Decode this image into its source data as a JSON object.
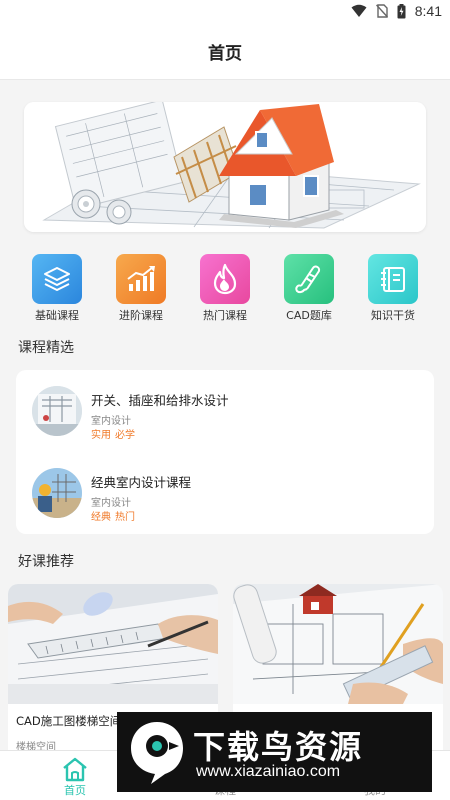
{
  "status_bar": {
    "time": "8:41"
  },
  "header": {
    "title": "首页"
  },
  "categories": [
    {
      "label": "基础课程",
      "icon": "layers-icon",
      "color": "#3aa0ea"
    },
    {
      "label": "进阶课程",
      "icon": "bar-chart-icon",
      "color": "#f39237"
    },
    {
      "label": "热门课程",
      "icon": "flame-icon",
      "color": "#f25fbe"
    },
    {
      "label": "CAD题库",
      "icon": "scroll-icon",
      "color": "#3fd496"
    },
    {
      "label": "知识干货",
      "icon": "notebook-icon",
      "color": "#3fd4d4"
    }
  ],
  "featured": {
    "title": "课程精选",
    "items": [
      {
        "title": "开关、插座和给排水设计",
        "category": "室内设计",
        "tags": [
          "实用",
          "必学"
        ]
      },
      {
        "title": "经典室内设计课程",
        "category": "室内设计",
        "tags": [
          "经典",
          "热门"
        ]
      }
    ]
  },
  "recommend": {
    "title": "好课推荐",
    "cards": [
      {
        "title": "CAD施工图楼梯空间",
        "subtitle": "楼梯空间"
      },
      {
        "title": "",
        "subtitle": ""
      }
    ]
  },
  "bottom_nav": [
    {
      "label": "首页",
      "icon": "home-icon",
      "active": true
    },
    {
      "label": "课程",
      "icon": "book-icon",
      "active": false
    },
    {
      "label": "我的",
      "icon": "user-icon",
      "active": false
    }
  ],
  "watermark": {
    "brand": "下载鸟资源",
    "url": "www.xiazainiao.com"
  },
  "colors": {
    "accent": "#2bc4b0",
    "tag": "#f07a2a"
  }
}
